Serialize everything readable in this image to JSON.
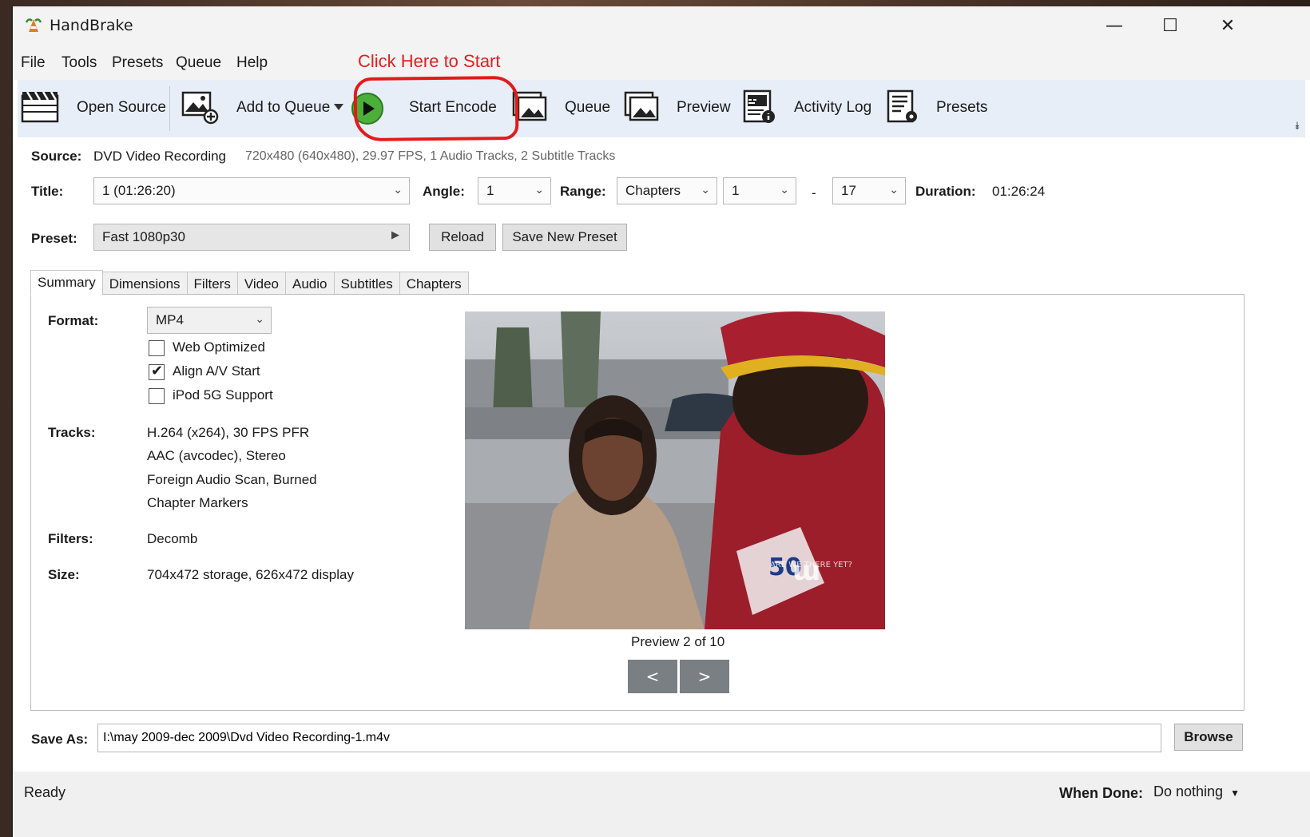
{
  "window": {
    "title": "HandBrake",
    "controls": {
      "minimize": "—",
      "maximize": "☐",
      "close": "✕"
    }
  },
  "menu": [
    "File",
    "Tools",
    "Presets",
    "Queue",
    "Help"
  ],
  "annotation": {
    "text": "Click Here to Start",
    "color": "#e41a1a"
  },
  "toolbar": {
    "open_source": "Open Source",
    "add_to_queue": "Add to Queue",
    "start_encode": "Start Encode",
    "queue": "Queue",
    "preview": "Preview",
    "activity_log": "Activity Log",
    "presets": "Presets",
    "overflow": "⯯"
  },
  "source": {
    "label": "Source:",
    "name": "DVD Video Recording",
    "info": "720x480 (640x480), 29.97 FPS, 1 Audio Tracks, 2 Subtitle Tracks"
  },
  "title_row": {
    "title_label": "Title:",
    "title_value": "1  (01:26:20)",
    "angle_label": "Angle:",
    "angle_value": "1",
    "range_label": "Range:",
    "range_type": "Chapters",
    "range_start": "1",
    "range_sep": "-",
    "range_end": "17",
    "duration_label": "Duration:",
    "duration_value": "01:26:24"
  },
  "preset_row": {
    "label": "Preset:",
    "value": "Fast 1080p30",
    "reload": "Reload",
    "save_new": "Save New Preset"
  },
  "tabs": [
    "Summary",
    "Dimensions",
    "Filters",
    "Video",
    "Audio",
    "Subtitles",
    "Chapters"
  ],
  "summary": {
    "format_label": "Format:",
    "format_value": "MP4",
    "options": [
      {
        "label": "Web Optimized",
        "checked": false
      },
      {
        "label": "Align A/V Start",
        "checked": true
      },
      {
        "label": "iPod 5G Support",
        "checked": false
      }
    ],
    "tracks_label": "Tracks:",
    "tracks": [
      "H.264 (x264), 30 FPS PFR",
      "AAC (avcodec), Stereo",
      "Foreign Audio Scan, Burned",
      "Chapter Markers"
    ],
    "filters_label": "Filters:",
    "filters_value": "Decomb",
    "size_label": "Size:",
    "size_value": "704x472 storage, 626x472 display"
  },
  "preview": {
    "caption": "Preview 2 of 10",
    "prev": "<",
    "next": ">",
    "watermark": "ARE WE THERE YET?"
  },
  "save": {
    "label": "Save As:",
    "path": "I:\\may 2009-dec 2009\\Dvd Video Recording-1.m4v",
    "browse": "Browse"
  },
  "status": {
    "text": "Ready",
    "when_done_label": "When Done:",
    "when_done_value": "Do nothing"
  }
}
